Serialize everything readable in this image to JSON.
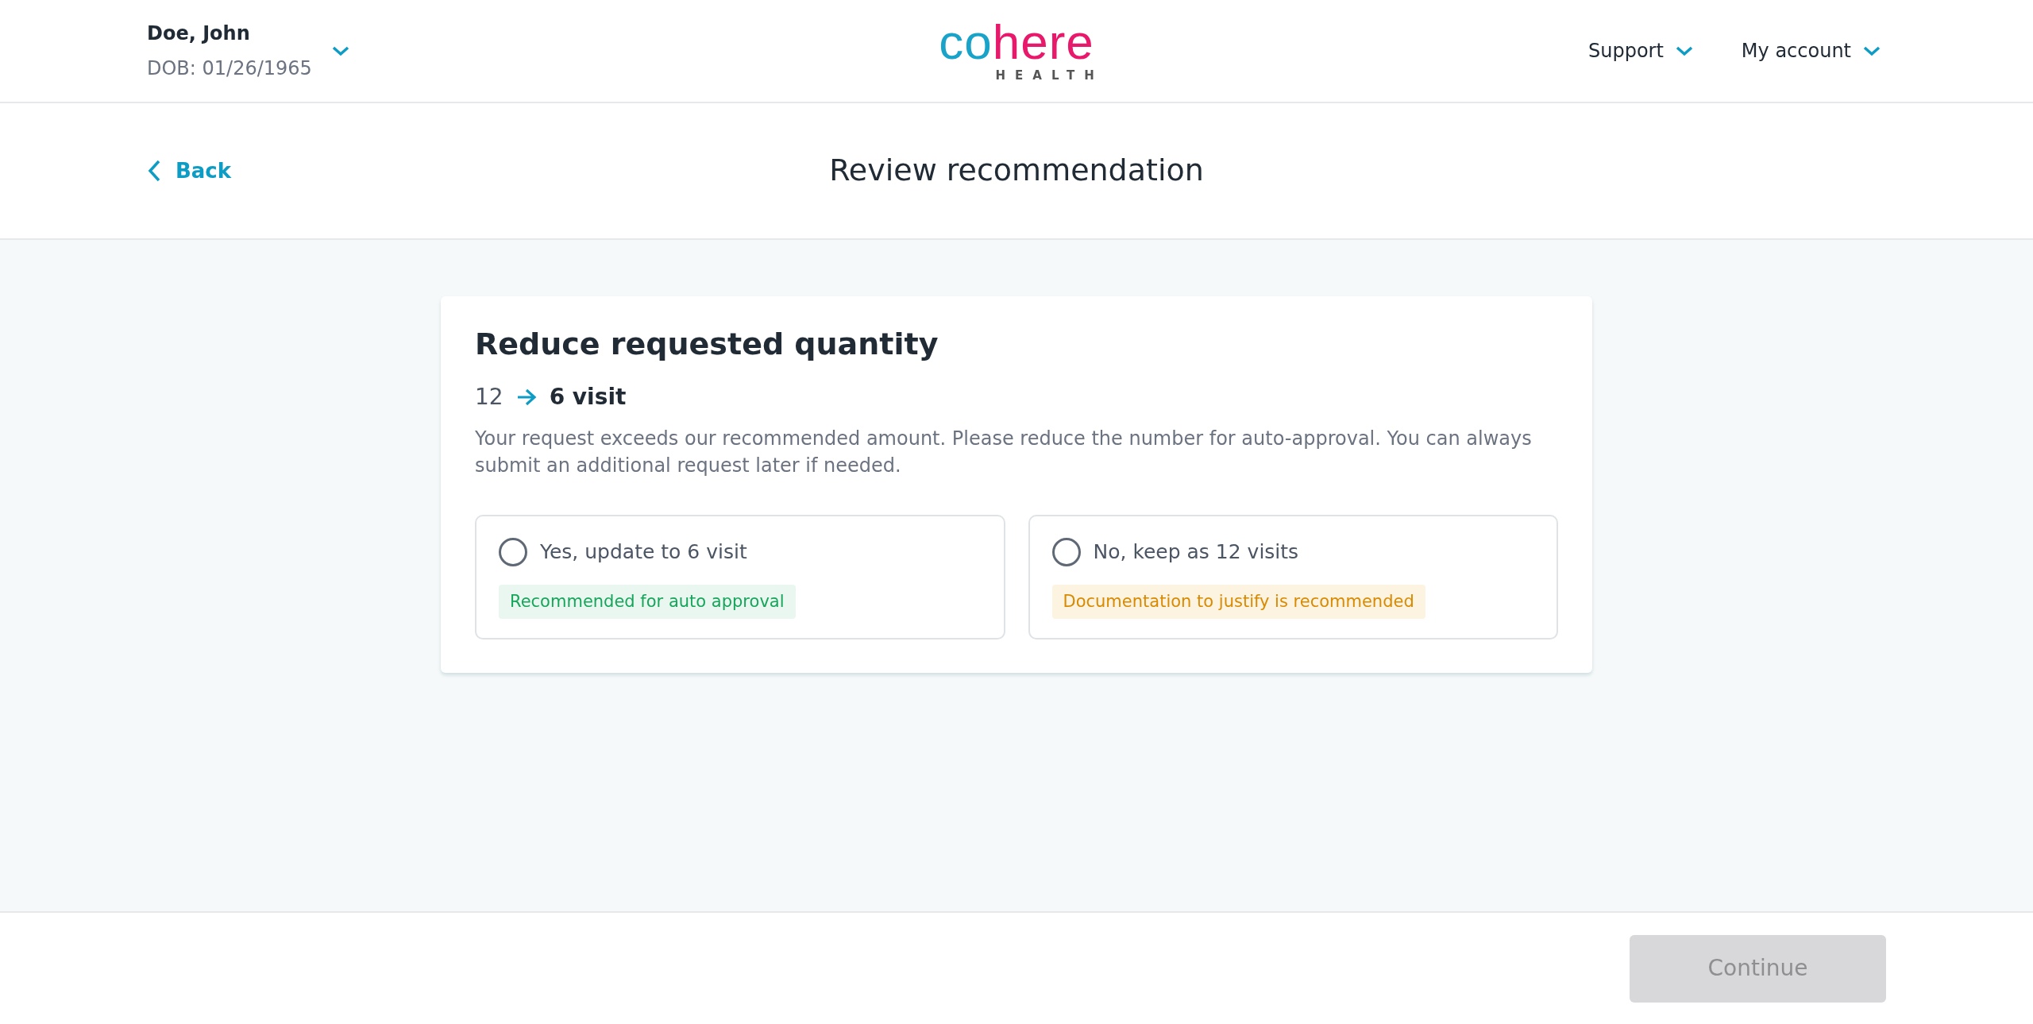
{
  "patient": {
    "name": "Doe, John",
    "dob": "DOB: 01/26/1965"
  },
  "logo": {
    "first": "co",
    "second": "here",
    "sub": "HEALTH"
  },
  "nav": [
    {
      "label": "Support"
    },
    {
      "label": "My account"
    }
  ],
  "back": {
    "label": "Back"
  },
  "page_title": "Review recommendation",
  "card": {
    "title": "Reduce requested quantity",
    "from": "12",
    "to": "6 visit",
    "description": "Your request exceeds our recommended amount. Please reduce the number for auto-approval. You can always submit an additional request later if needed.",
    "options": [
      {
        "label": "Yes, update to 6 visit",
        "selected": false,
        "tag": {
          "kind": "success",
          "text": "Recommended for auto approval"
        }
      },
      {
        "label": "No, keep as 12 visits",
        "selected": false,
        "tag": {
          "kind": "warning",
          "text": "Documentation to justify is recommended"
        }
      }
    ]
  },
  "footer": {
    "button": {
      "label": "Continue",
      "disabled": true
    }
  }
}
